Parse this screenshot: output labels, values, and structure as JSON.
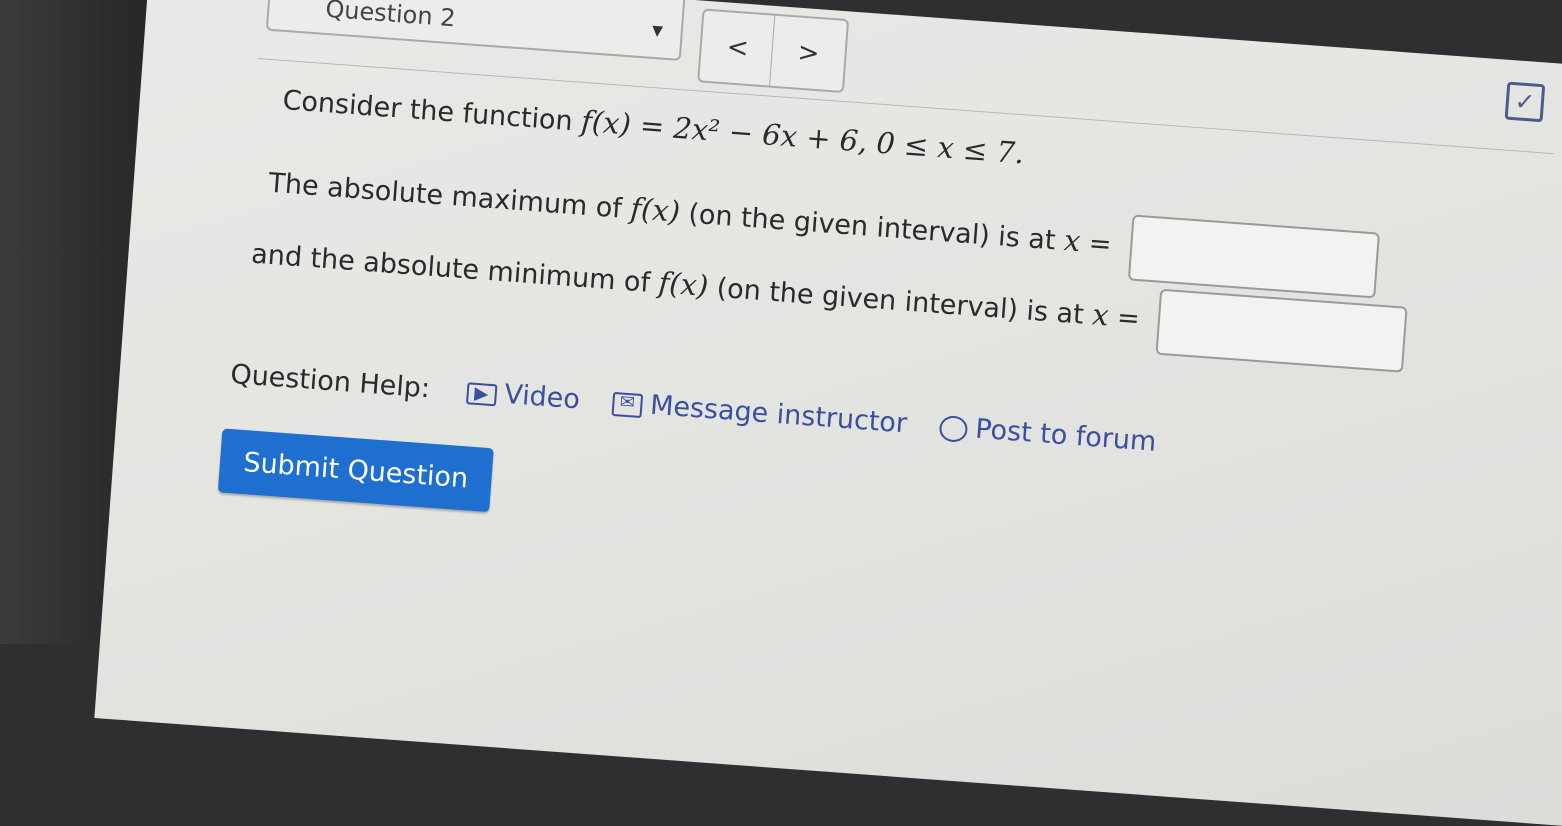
{
  "header": {
    "question_label": "Question 2",
    "prev_label": "<",
    "next_label": ">"
  },
  "problem": {
    "intro": "Consider the function",
    "function_expr": "f(x) = 2x² − 6x + 6,   0 ≤ x ≤ 7.",
    "max_prefix": "The absolute maximum of",
    "max_fx": "f(x)",
    "max_suffix": "(on the given interval) is at",
    "max_var": "x",
    "equals": "=",
    "min_prefix": "and the absolute minimum of",
    "min_fx": "f(x)",
    "min_suffix": "(on the given interval) is at",
    "min_var": "x",
    "max_answer": "",
    "min_answer": ""
  },
  "help": {
    "label": "Question Help:",
    "video": "Video",
    "message": "Message instructor",
    "forum": "Post to forum"
  },
  "submit_label": "Submit Question",
  "colors": {
    "accent": "#1f6fd0",
    "link": "#3a4fa0"
  },
  "icons": [
    "caret-down-icon",
    "check-square-icon",
    "video-icon",
    "mail-icon",
    "chat-bubble-icon"
  ]
}
